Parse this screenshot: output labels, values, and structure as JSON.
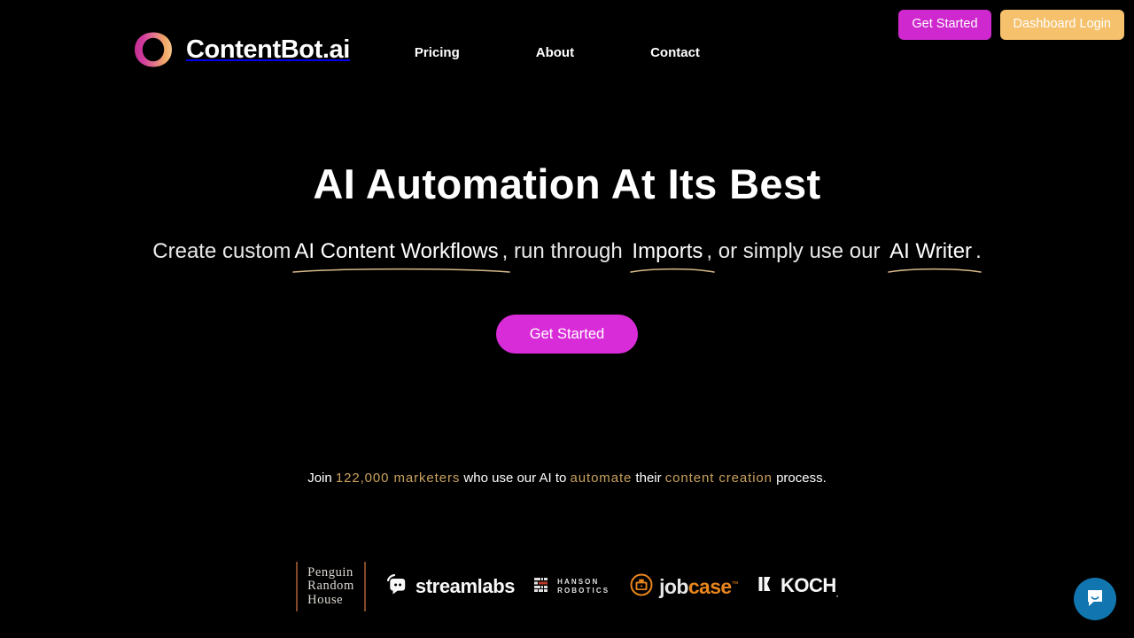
{
  "site": {
    "brand_name": "ContentBot.ai",
    "background_color": "#000000"
  },
  "header": {
    "nav": [
      {
        "label": "Pricing"
      },
      {
        "label": "About"
      },
      {
        "label": "Contact"
      }
    ],
    "actions": {
      "get_started_label": "Get Started",
      "get_started_color": "#CE28CE",
      "dashboard_login_label": "Dashboard Login",
      "dashboard_login_color": "#F6C16C"
    }
  },
  "hero": {
    "headline": "AI Automation At Its Best",
    "subhead": {
      "part1": "Create custom",
      "highlight1": "AI Content Workflows",
      "part2": ", run through ",
      "highlight2": "Imports",
      "part3": ", or simply use our ",
      "highlight3": "AI Writer",
      "part4": ".",
      "underline_color": "#D9B98A"
    },
    "cta_label": "Get Started",
    "cta_color": "#D92CD9"
  },
  "social_proof": {
    "prefix": "Join ",
    "count": "122,000 marketers",
    "middle1": " who use our AI to ",
    "action": "automate",
    "middle2": " their ",
    "topic": "content creation",
    "suffix": " process.",
    "accent_color": "#C9A15E"
  },
  "logos": [
    {
      "name": "Penguin Random House",
      "line1": "Penguin",
      "line2": "Random",
      "line3": "House"
    },
    {
      "name": "Streamlabs",
      "text": "streamlabs"
    },
    {
      "name": "Hanson Robotics",
      "line1": "HANSON",
      "line2": "ROBOTICS"
    },
    {
      "name": "Jobcase",
      "part1": "job",
      "part2": "case",
      "tm": "™"
    },
    {
      "name": "Koch",
      "text": "KOCH",
      "tm": "."
    }
  ],
  "chat_widget": {
    "name": "chat-launcher",
    "color": "#1176AF"
  }
}
